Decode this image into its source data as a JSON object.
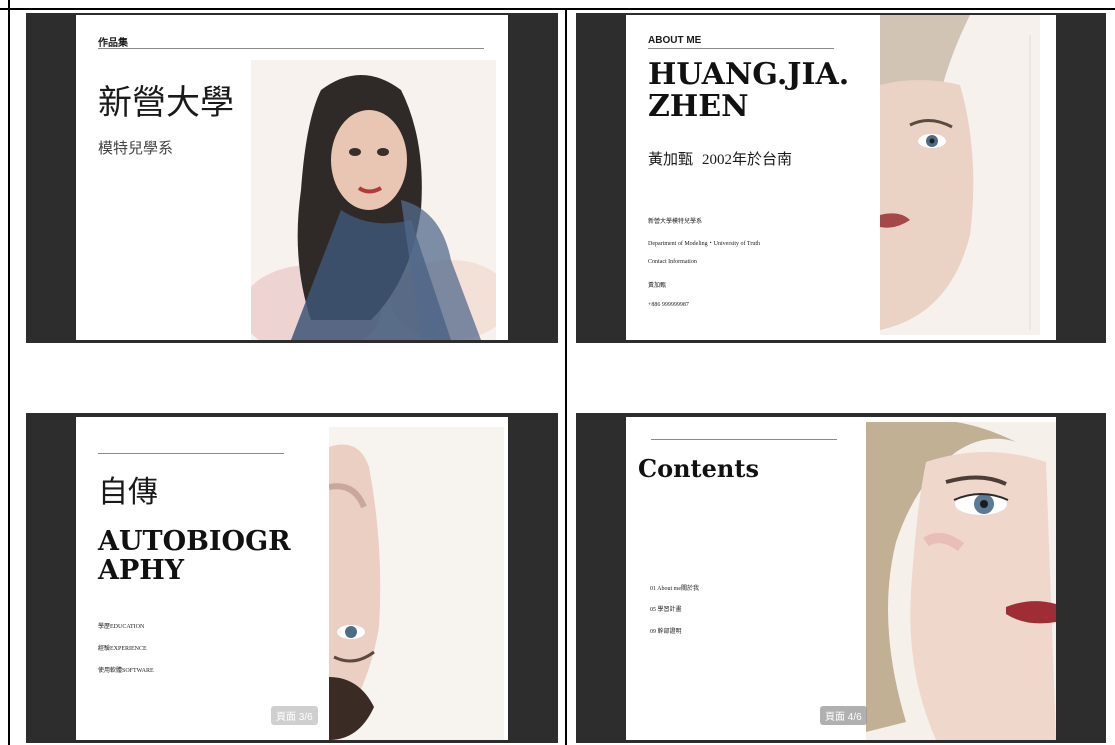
{
  "slide1": {
    "kicker": "作品集",
    "title": "新營大學",
    "subtitle": "模特兒學系"
  },
  "slide2": {
    "kicker": "ABOUT ME",
    "name_line1": "HUANG.JIA.",
    "name_line2": "ZHEN",
    "name_zh": "黃加甄",
    "birth": "2002年於台南",
    "details": [
      "新營大學模特兒學系",
      "Department of Modeling・University of Truth",
      "Contact Information",
      "黃加甄",
      "+886 999999987"
    ]
  },
  "slide3": {
    "title_zh": "自傳",
    "title_en_line1": "AUTOBIOGR",
    "title_en_line2": "APHY",
    "items": [
      "學歷EDUCATION",
      "經驗EXPERIENCE",
      "使用軟體SOFTWARE"
    ],
    "page_badge": "頁面 3/6"
  },
  "slide4": {
    "title": "Contents",
    "items": [
      "01 About me關於我",
      "05 學習計畫",
      "09 幹部證明"
    ],
    "page_badge": "頁面 4/6"
  },
  "colors": {
    "frame": "#2d2d2d",
    "page": "#ffffff",
    "rule": "#8a8a8a",
    "text": "#1a1a1a"
  }
}
